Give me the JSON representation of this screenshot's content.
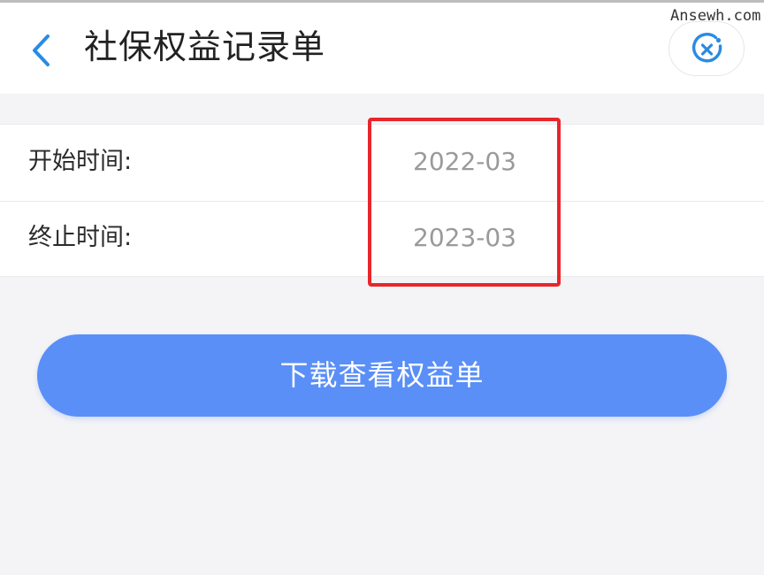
{
  "watermark": "Ansewh.com",
  "header": {
    "title": "社保权益记录单",
    "back_icon": "chevron-left-icon",
    "close_icon": "close-circle-icon",
    "accent_color": "#2a8be3"
  },
  "form": {
    "rows": [
      {
        "label": "开始时间:",
        "value": "2022-03"
      },
      {
        "label": "终止时间:",
        "value": "2023-03"
      }
    ],
    "highlight_color": "#e8262b"
  },
  "actions": {
    "download_label": "下载查看权益单",
    "button_color": "#5a8ff7"
  }
}
